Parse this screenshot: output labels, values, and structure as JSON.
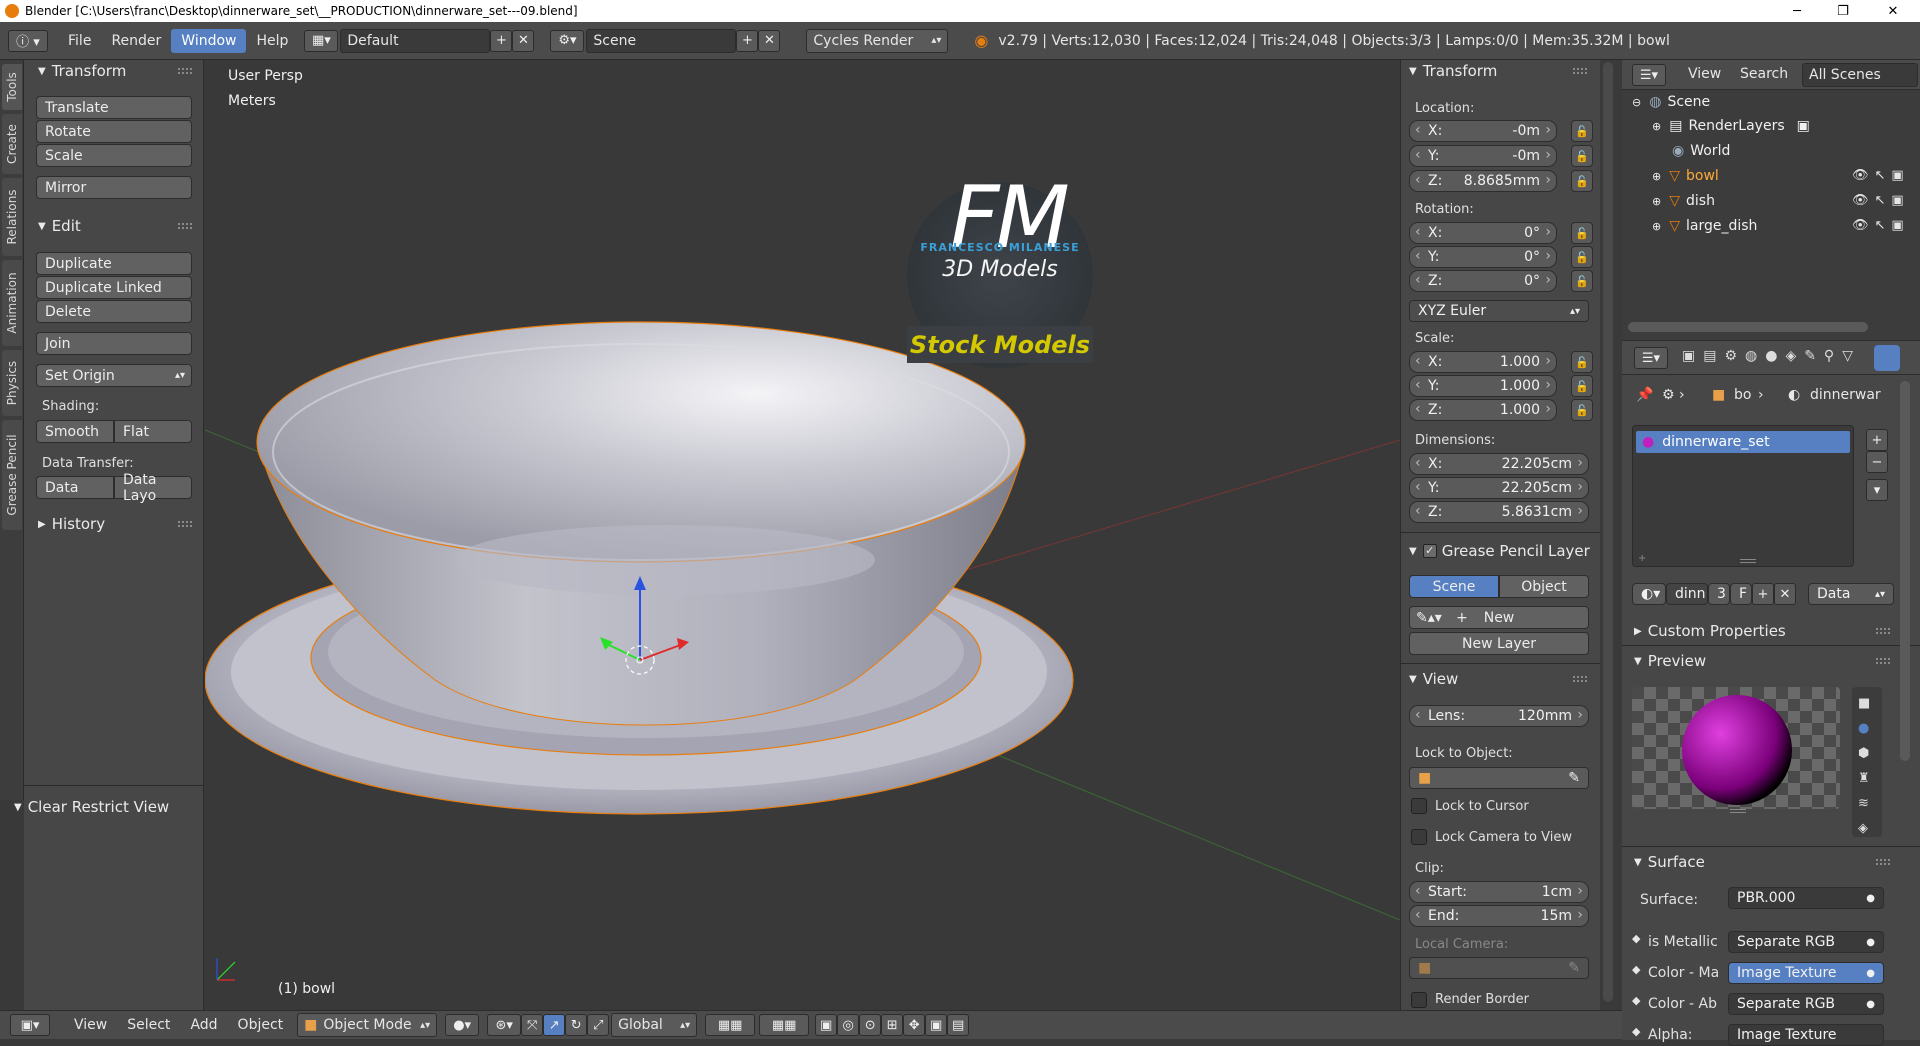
{
  "window": {
    "title": "Blender [C:\\Users\\franc\\Desktop\\dinnerware_set\\__PRODUCTION\\dinnerware_set---09.blend]",
    "minimize": "─",
    "maximize": "❐",
    "close": "✕"
  },
  "menu": {
    "file": "File",
    "render": "Render",
    "window": "Window",
    "help": "Help"
  },
  "header": {
    "layout": "Default",
    "scene": "Scene",
    "engine": "Cycles Render",
    "stats": "v2.79 | Verts:12,030 | Faces:12,024 | Tris:24,048 | Objects:3/3 | Lamps:0/0 | Mem:35.32M | bowl"
  },
  "tool_tabs": [
    "Tools",
    "Create",
    "Relations",
    "Animation",
    "Physics",
    "Grease Pencil"
  ],
  "toolshelf": {
    "transform_title": "Transform",
    "translate": "Translate",
    "rotate": "Rotate",
    "scale": "Scale",
    "mirror": "Mirror",
    "edit_title": "Edit",
    "duplicate": "Duplicate",
    "duplicate_linked": "Duplicate Linked",
    "delete": "Delete",
    "join": "Join",
    "set_origin": "Set Origin",
    "shading_label": "Shading:",
    "smooth": "Smooth",
    "flat": "Flat",
    "data_transfer_label": "Data Transfer:",
    "data": "Data",
    "data_layo": "Data Layo",
    "history_title": "History",
    "clear_restrict_view": "Clear Restrict View"
  },
  "viewport": {
    "view_name": "User Persp",
    "units": "Meters",
    "active_object": "(1) bowl",
    "logo_letters": "FM",
    "logo_name": "FRANCESCO MILANESE",
    "logo_sub": "3D Models",
    "stock": "Stock Models"
  },
  "npanel": {
    "transform_title": "Transform",
    "location_label": "Location:",
    "loc": [
      {
        "k": "X:",
        "v": "-0m"
      },
      {
        "k": "Y:",
        "v": "-0m"
      },
      {
        "k": "Z:",
        "v": "8.8685mm"
      }
    ],
    "rotation_label": "Rotation:",
    "rot": [
      {
        "k": "X:",
        "v": "0°"
      },
      {
        "k": "Y:",
        "v": "0°"
      },
      {
        "k": "Z:",
        "v": "0°"
      }
    ],
    "rotation_mode": "XYZ Euler",
    "scale_label": "Scale:",
    "scale": [
      {
        "k": "X:",
        "v": "1.000"
      },
      {
        "k": "Y:",
        "v": "1.000"
      },
      {
        "k": "Z:",
        "v": "1.000"
      }
    ],
    "dimensions_label": "Dimensions:",
    "dim": [
      {
        "k": "X:",
        "v": "22.205cm"
      },
      {
        "k": "Y:",
        "v": "22.205cm"
      },
      {
        "k": "Z:",
        "v": "5.8631cm"
      }
    ],
    "gp_title": "Grease Pencil Layer",
    "gp_scene": "Scene",
    "gp_object": "Object",
    "gp_new": "New",
    "gp_new_layer": "New Layer",
    "view_title": "View",
    "lens_k": "Lens:",
    "lens_v": "120mm",
    "lock_to_object": "Lock to Object:",
    "lock_cursor": "Lock to Cursor",
    "lock_camera": "Lock Camera to View",
    "clip_label": "Clip:",
    "clip_start_k": "Start:",
    "clip_start_v": "1cm",
    "clip_end_k": "End:",
    "clip_end_v": "15m",
    "local_camera": "Local Camera:",
    "render_border": "Render Border"
  },
  "outliner": {
    "view": "View",
    "search": "Search",
    "filter": "All Scenes",
    "scene": "Scene",
    "renderlayers": "RenderLayers",
    "world": "World",
    "objects": [
      "bowl",
      "dish",
      "large_dish"
    ]
  },
  "properties": {
    "crumb_obj": "bo",
    "crumb_mat": "dinnerwar",
    "slot_material": "dinnerware_set",
    "mat_name": "dinn",
    "mat_users": "3",
    "mat_fake": "F",
    "mat_link": "Data",
    "custom_props": "Custom Properties",
    "preview": "Preview",
    "surface_title": "Surface",
    "surface_label": "Surface:",
    "surface_value": "PBR.000",
    "inputs": [
      {
        "k": "is Metallic",
        "v": "Separate RGB"
      },
      {
        "k": "Color - Ma",
        "v": "Image Texture"
      },
      {
        "k": "Color - Ab",
        "v": "Separate RGB"
      },
      {
        "k": "Alpha:",
        "v": "Image Texture"
      }
    ]
  },
  "footer": {
    "view": "View",
    "select": "Select",
    "add": "Add",
    "object": "Object",
    "mode": "Object Mode",
    "orientation": "Global"
  },
  "colors": {
    "accent": "#5680c2",
    "selected_outline": "#e87d0d",
    "logo_text": "#3aa0d6",
    "stock_text": "#d4c800"
  }
}
